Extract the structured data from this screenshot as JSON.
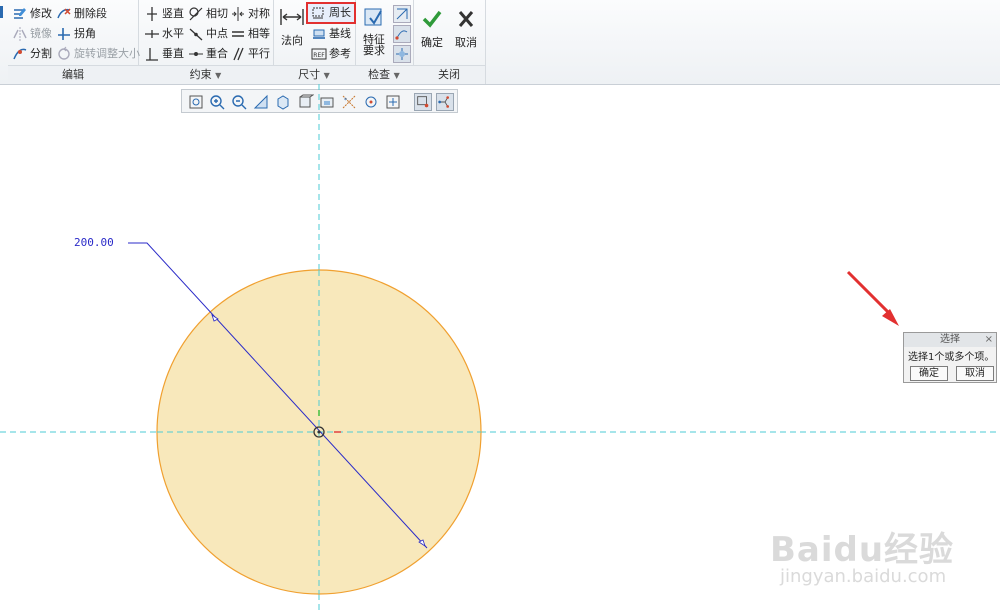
{
  "ribbon": {
    "edit": {
      "label": "编辑",
      "modify": "修改",
      "delete_segment": "删除段",
      "mirror": "镜像",
      "corner": "拐角",
      "divide": "分割",
      "rotate_resize": "旋转调整大小"
    },
    "constrain": {
      "label": "约束",
      "vertical": "竖直",
      "tangent": "相切",
      "symmetric": "对称",
      "horizontal": "水平",
      "midpoint": "中点",
      "equal": "相等",
      "perpendicular": "垂直",
      "coincident": "重合",
      "parallel": "平行"
    },
    "dimension": {
      "label": "尺寸",
      "normal": "法向",
      "perimeter": "周长",
      "baseline": "基线",
      "reference": "参考"
    },
    "inspect": {
      "label": "检查",
      "feature_requirements_line1": "特征",
      "feature_requirements_line2": "要求"
    },
    "close": {
      "label": "关闭",
      "ok": "确定",
      "cancel": "取消"
    }
  },
  "sketch": {
    "dimension_value": "200.00"
  },
  "select_dialog": {
    "title": "选择",
    "message": "选择1个或多个项。",
    "ok": "确定",
    "cancel": "取消"
  },
  "watermark": {
    "brand": "Baidu经验",
    "url": "jingyan.baidu.com"
  },
  "colors": {
    "circle_fill": "#f8e8bb",
    "circle_stroke": "#f0a030",
    "centerline": "#4ecbd6",
    "dimension": "#2b2bc8",
    "highlight": "#e23030",
    "ok_check": "#2f9a3a"
  }
}
